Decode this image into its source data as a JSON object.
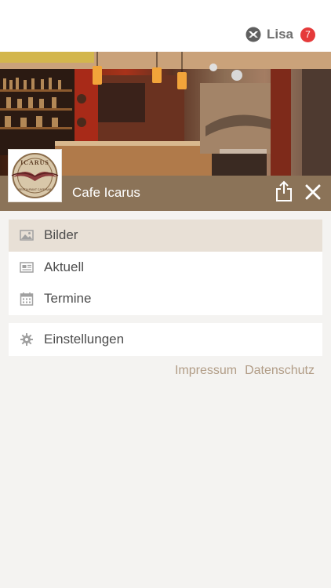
{
  "user": {
    "name": "Lisa",
    "badge_count": "7",
    "icon": "swirl-logo-icon"
  },
  "venue": {
    "name": "Cafe Icarus",
    "logo_text": "ICARUS",
    "logo_subtext": "RESTAURANT CAFE BAR"
  },
  "header": {
    "share_icon": "share-icon",
    "close_icon": "close-icon"
  },
  "menu": {
    "items": [
      {
        "label": "Bilder",
        "icon": "image-icon",
        "active": true
      },
      {
        "label": "Aktuell",
        "icon": "newspaper-icon",
        "active": false
      },
      {
        "label": "Termine",
        "icon": "calendar-icon",
        "active": false
      }
    ],
    "settings": {
      "label": "Einstellungen",
      "icon": "gear-icon"
    }
  },
  "footer": {
    "impressum": "Impressum",
    "datenschutz": "Datenschutz"
  },
  "colors": {
    "accent_brown": "#8b7358",
    "active_row": "#e8e0d6",
    "link": "#b19c86",
    "badge": "#e53a3a",
    "background": "#f4f3f1"
  }
}
